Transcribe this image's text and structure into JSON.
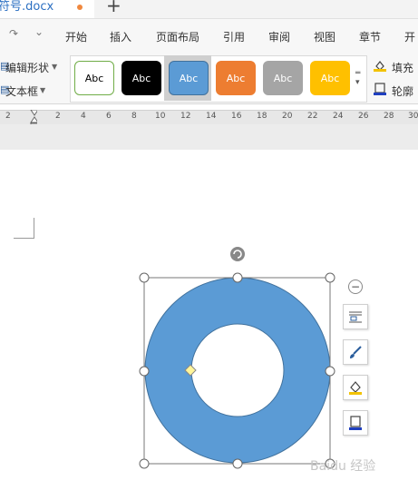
{
  "tab": {
    "title": "符号.docx",
    "new_tab_symbol": "+"
  },
  "quick_access": {
    "redo_symbol": "↷",
    "dropdown_symbol": "⌄"
  },
  "menu": [
    "开始",
    "插入",
    "页面布局",
    "引用",
    "审阅",
    "视图",
    "章节",
    "开"
  ],
  "ribbon": {
    "edit_shape_label": "编辑形状",
    "text_box_label": "文本框",
    "fill_label": "填充",
    "outline_label": "轮廓",
    "styles": [
      {
        "label": "Abc",
        "bg": "#ffffff",
        "fg": "#000000",
        "border": "#70ad47"
      },
      {
        "label": "Abc",
        "bg": "#000000",
        "fg": "#ffffff",
        "border": "#000000"
      },
      {
        "label": "Abc",
        "bg": "#5b9bd5",
        "fg": "#ffffff",
        "border": "#41719c"
      },
      {
        "label": "Abc",
        "bg": "#ed7d31",
        "fg": "#ffffff",
        "border": "#ed7d31"
      },
      {
        "label": "Abc",
        "bg": "#a5a5a5",
        "fg": "#ffffff",
        "border": "#a5a5a5"
      },
      {
        "label": "Abc",
        "bg": "#ffc000",
        "fg": "#ffffff",
        "border": "#ffc000"
      }
    ],
    "selected_style_index": 2
  },
  "ruler": {
    "ticks": [
      "2",
      "2",
      "4",
      "6",
      "8",
      "10",
      "12",
      "14",
      "16",
      "18",
      "20",
      "22",
      "24",
      "26",
      "28",
      "30"
    ]
  },
  "shape": {
    "type": "donut",
    "fill": "#5b9bd5",
    "stroke": "#41719c",
    "rotate_symbol": "⟳"
  },
  "side_toolbar": {
    "collapse_symbol": "−"
  },
  "watermark": "Baidu 经验"
}
